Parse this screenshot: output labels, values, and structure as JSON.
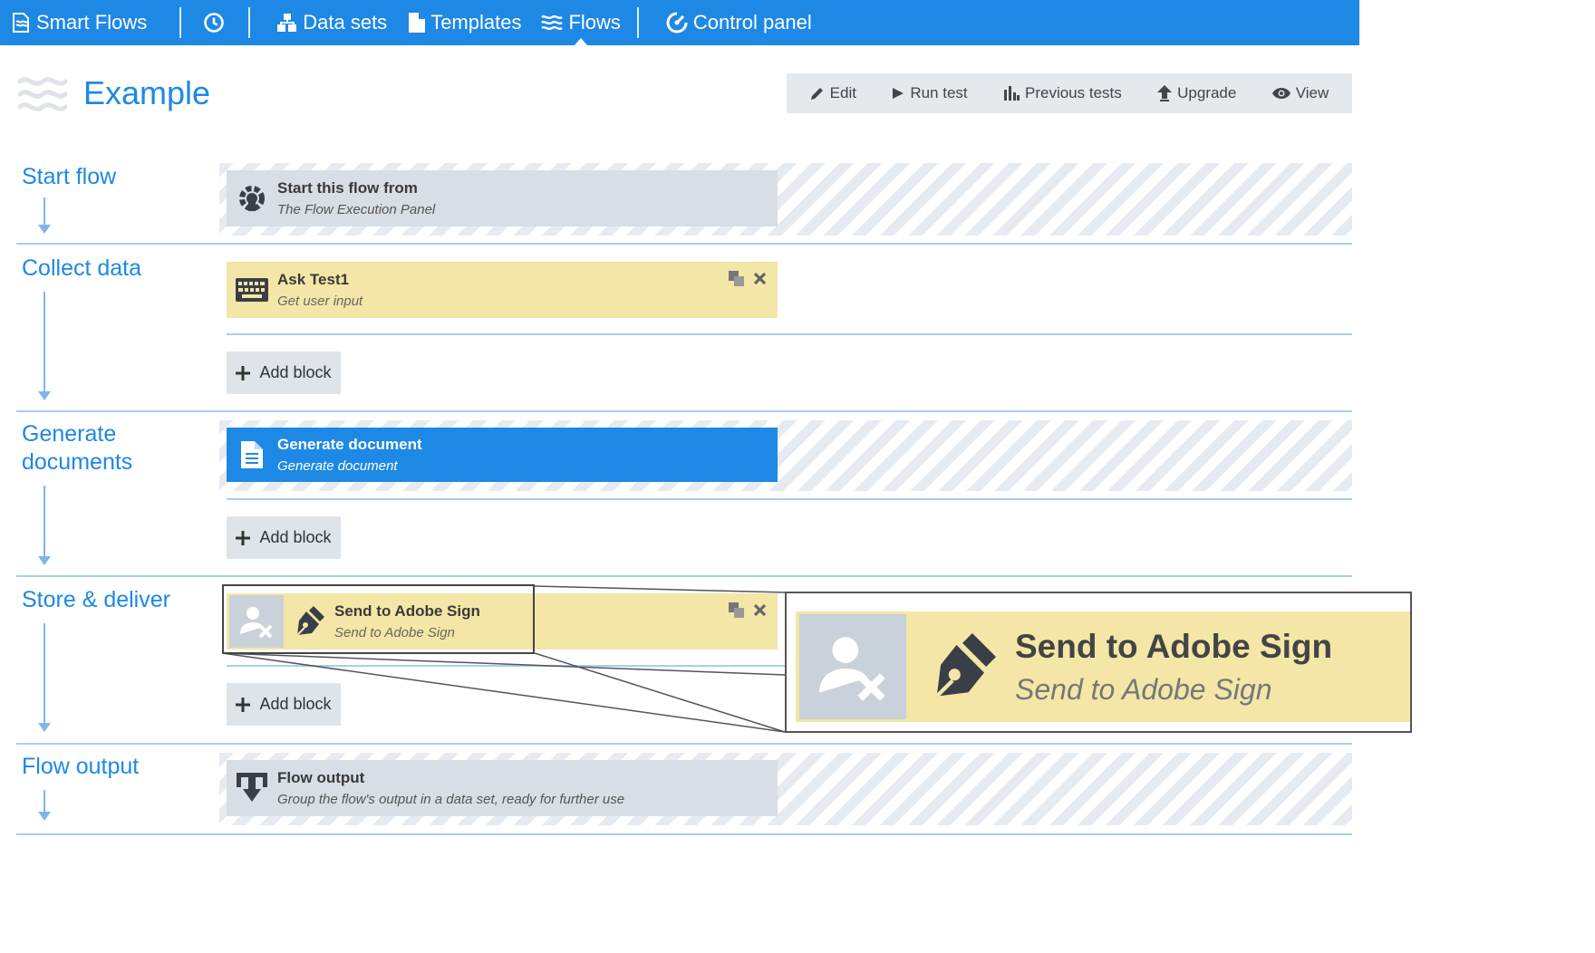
{
  "nav": {
    "brand": "Smart Flows",
    "items": [
      {
        "label": "Data sets",
        "icon": "sitemap-icon"
      },
      {
        "label": "Templates",
        "icon": "document-icon"
      },
      {
        "label": "Flows",
        "icon": "waves-icon",
        "active": true
      },
      {
        "label": "Control panel",
        "icon": "gauge-icon"
      }
    ],
    "history_icon": "clock-icon"
  },
  "page": {
    "title": "Example",
    "icon": "waves-icon"
  },
  "toolbar": {
    "edit": "Edit",
    "run_test": "Run test",
    "previous_tests": "Previous tests",
    "upgrade": "Upgrade",
    "view": "View"
  },
  "sections": {
    "start": {
      "label": "Start flow",
      "block": {
        "title": "Start this flow from",
        "subtitle": "The Flow Execution Panel",
        "icon": "gear-cog-icon"
      }
    },
    "collect": {
      "label": "Collect data",
      "block": {
        "title": "Ask Test1",
        "subtitle": "Get user input",
        "icon": "keyboard-icon"
      },
      "add_block": "Add block"
    },
    "generate": {
      "label_line1": "Generate",
      "label_line2": "documents",
      "block": {
        "title": "Generate document",
        "subtitle": "Generate document",
        "icon": "document-icon"
      },
      "add_block": "Add block"
    },
    "store": {
      "label": "Store & deliver",
      "block": {
        "title": "Send to Adobe Sign",
        "subtitle": "Send to Adobe Sign",
        "icon": "pen-nib-icon",
        "status_icon": "user-remove-icon"
      },
      "add_block": "Add block"
    },
    "output": {
      "label": "Flow output",
      "block": {
        "title": "Flow output",
        "subtitle": "Group the flow's output in a data set, ready for further use",
        "icon": "download-icon"
      }
    }
  },
  "zoom": {
    "title": "Send to Adobe Sign",
    "subtitle": "Send to Adobe Sign"
  },
  "colors": {
    "primary": "#1e88e5",
    "block_grey": "#d8dee5",
    "block_yellow": "#f4e6a6",
    "divider": "#a9cdef"
  }
}
